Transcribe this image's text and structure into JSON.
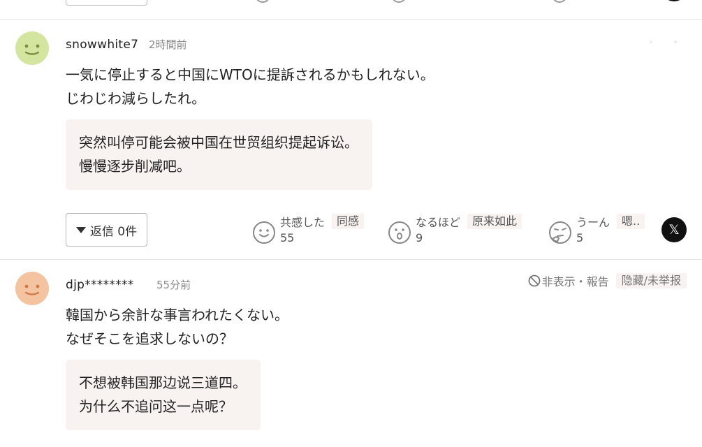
{
  "colors": {
    "translation_bg": "#f8f2f1",
    "avatar_green": "#d4e5a0",
    "avatar_orange": "#f4c39f",
    "x_button": "#111111"
  },
  "comments": [
    {
      "avatar_icon": "smiley-face-icon",
      "username": "snowwhite7",
      "time": "2時間前",
      "body": "一気に停止すると中国にWTOに提訴されるかもしれない。\nじわじわ減らしたれ。",
      "translation": "突然叫停可能会被中国在世贸组织提起诉讼。\n慢慢逐步削减吧。",
      "reply_label": "返信 0件",
      "reactions": [
        {
          "icon": "smile-icon",
          "label": "共感した",
          "translation": "同感",
          "count": "55"
        },
        {
          "icon": "surprised-icon",
          "label": "なるほど",
          "translation": "原来如此",
          "count": "9"
        },
        {
          "icon": "thinking-icon",
          "label": "うーん",
          "translation": "嗯..",
          "count": "5"
        }
      ],
      "share_label": "𝕏"
    },
    {
      "avatar_icon": "smiley-face-icon",
      "username": "djp********",
      "time": "55分前",
      "report_label": "非表示・報告",
      "report_translation": "隐藏/未举报",
      "body": "韓国から余計な事言われたくない。\nなぜそこを追求しないの？",
      "translation": "不想被韩国那边说三道四。\n为什么不追问这一点呢？"
    }
  ]
}
